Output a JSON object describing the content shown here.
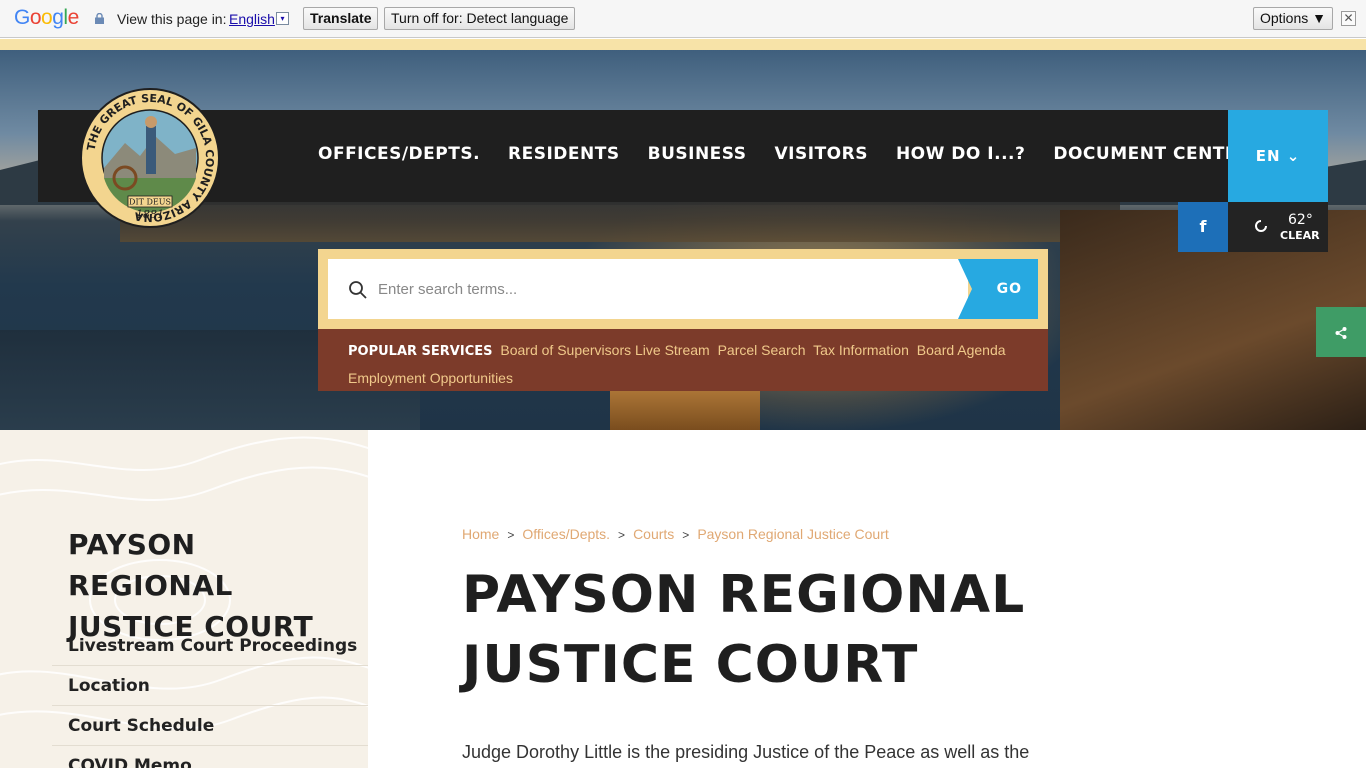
{
  "translate_bar": {
    "logo_letters": [
      "G",
      "o",
      "o",
      "g",
      "l",
      "e"
    ],
    "view_label": "View this page in:",
    "language": "English",
    "language_arrow": "▾",
    "translate_button": "Translate",
    "turn_off_button": "Turn off for: Detect language",
    "options_button": "Options ▼",
    "close": "✕"
  },
  "nav": {
    "items": [
      "OFFICES/DEPTS.",
      "RESIDENTS",
      "BUSINESS",
      "VISITORS",
      "HOW DO I...?",
      "DOCUMENT CENTER"
    ],
    "language": "EN ⌄",
    "facebook": "f",
    "weather_temp": "62°",
    "weather_condition": "CLEAR",
    "share_icon": "share-icon"
  },
  "logo": {
    "ring_text": "THE GREAT SEAL OF GILA COUNTY ARIZONA",
    "motto": "DIT DEUS",
    "year": "1881"
  },
  "search": {
    "placeholder": "Enter search terms...",
    "go": "GO"
  },
  "popular_services": {
    "label": "POPULAR SERVICES",
    "links": [
      "Board of Supervisors Live Stream",
      "Parcel Search",
      "Tax Information",
      "Board Agenda",
      "Employment Opportunities"
    ]
  },
  "sidebar": {
    "title": "PAYSON REGIONAL JUSTICE COURT",
    "items": [
      "Livestream Court Proceedings",
      "Location",
      "Court Schedule",
      "COVID Memo"
    ]
  },
  "breadcrumb": [
    "Home",
    "Offices/Depts.",
    "Courts",
    "Payson Regional Justice Court"
  ],
  "main": {
    "title": "PAYSON REGIONAL JUSTICE COURT",
    "intro": "Judge Dorothy Little is the presiding Justice of the Peace as well as the"
  },
  "colors": {
    "accent_blue": "#27a9e1",
    "brown": "#7c3b2a",
    "sand": "#f3d58f",
    "green": "#3f9c66"
  }
}
